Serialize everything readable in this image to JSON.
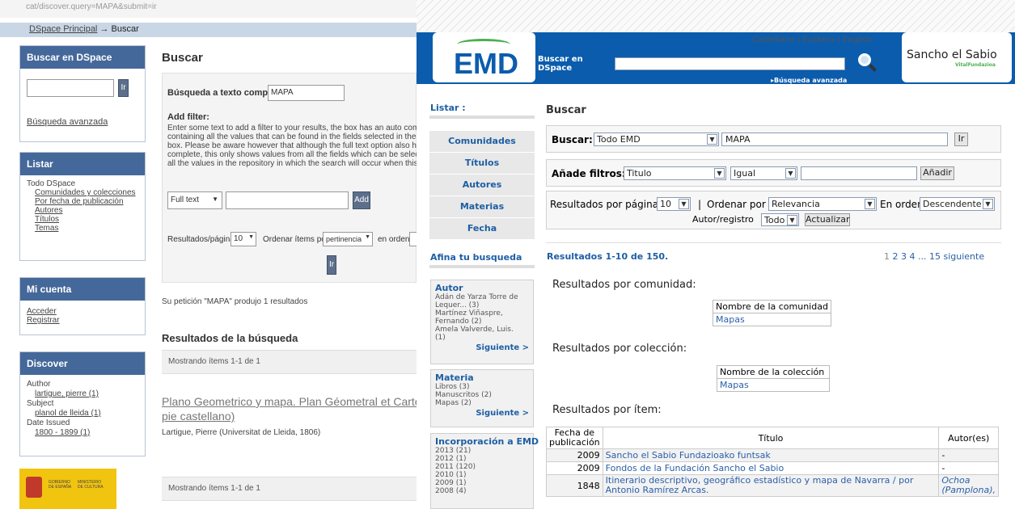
{
  "left": {
    "url": "cat/discover.query=MAPA&submit=ir",
    "breadcrumb": {
      "home": "DSpace Principal",
      "sep": "→",
      "current": "Buscar"
    },
    "search_box": {
      "title": "Buscar en DSpace",
      "go": "Ir",
      "advanced": "Búsqueda avanzada"
    },
    "browse": {
      "title": "Listar",
      "root": "Todo DSpace",
      "links": [
        "Comunidades y colecciones",
        "Por fecha de publicación",
        "Autores",
        "Títulos",
        "Temas"
      ]
    },
    "account": {
      "title": "Mi cuenta",
      "links": [
        "Acceder",
        "Registrar"
      ]
    },
    "discover": {
      "title": "Discover",
      "author_label": "Author",
      "author_value": "lartigue, pierre (1)",
      "subject_label": "Subject",
      "subject_value": "planol de lleida (1)",
      "date_label": "Date Issued",
      "date_value": "1800 - 1899 (1)"
    },
    "logo": {
      "line1": "GOBIERNO",
      "line1b": "DE ESPAÑA",
      "line2": "MINISTERIO",
      "line2b": "DE CULTURA"
    },
    "main": {
      "title": "Buscar",
      "fulltext_label": "Búsqueda a texto completo:",
      "fulltext_value": "MAPA",
      "addfilter_title": "Add filter:",
      "addfilter_help": [
        "Enter some text to add a filter to your results, the box has an auto complete functio",
        "containing all the values that can be found in the fields selected in the dropdow",
        "box. Please be aware however that although the full text option also has an aut",
        "complete, this only shows values from all the fields which can be selected & not fo",
        "all the values in the repository in which the search will occur when this is selected."
      ],
      "filter_select": "Full text",
      "add_btn": "Add",
      "results_per_page_label": "Resultados/página",
      "results_per_page": "10",
      "order_by_label": "Ordenar ítems por",
      "order_by": "pertinencia",
      "order_label": "en orden",
      "go": "Ir",
      "request_msg": "Su petición \"MAPA\" produjo 1 resultados",
      "results_title": "Resultados de la búsqueda",
      "showing": "Mostrando ítems 1-1 de 1",
      "item_title_1": "Plano Geometrico y mapa. Plan Géometral et Carte. Geometral Pl",
      "item_title_2": "pie castellano)",
      "item_meta": "Lartigue, Pierre (Universitat de Lleida, 1806)",
      "showing_bottom": "Mostrando ítems 1-1 de 1"
    }
  },
  "right": {
    "langs": [
      "Castellano",
      "Euskera",
      "English"
    ],
    "lang_sep": "|",
    "logo_text": "EMD",
    "search_label": "Buscar en DSpace",
    "advanced": "▸Búsqueda avanzada",
    "sancho": {
      "title": "Sancho el Sabio",
      "sub": "VitalFundazioa"
    },
    "browse_title": "Listar :",
    "browse_tabs": [
      "Comunidades",
      "Títulos",
      "Autores",
      "Materias",
      "Fecha"
    ],
    "refine_title": "Afina tu busqueda",
    "facets": {
      "author": {
        "title": "Autor",
        "items": [
          "Adán de Yarza Torre de",
          "Lequer... (3)",
          "Martínez Viñaspre,",
          "Fernando (2)",
          "Amela Valverde, Luis.",
          "(1)"
        ],
        "next": "Siguiente >"
      },
      "subject": {
        "title": "Materia",
        "items": [
          "Libros (3)",
          "Manuscritos (2)",
          "Mapas (2)"
        ],
        "next": "Siguiente >"
      },
      "date": {
        "title": "Incorporación a EMD",
        "items": [
          "2013 (21)",
          "2012 (1)",
          "2011 (120)",
          "2010 (1)",
          "2009 (1)",
          "2008 (4)"
        ]
      }
    },
    "main": {
      "title": "Buscar",
      "search_label": "Buscar:",
      "scope": "Todo EMD",
      "query": "MAPA",
      "go": "Ir",
      "filters_label": "Añade filtros:",
      "filter_field": "Titulo",
      "filter_op": "Igual",
      "add_btn": "Añadir",
      "rpp_label": "Resultados por página",
      "rpp": "10",
      "sep": "|",
      "order_by_label": "Ordenar por",
      "order_by": "Relevancia",
      "order_label": "En orden",
      "order": "Descendente",
      "author_label": "Autor/registro",
      "author_value": "Todo",
      "update_btn": "Actualizar",
      "results_summary": "Resultados 1-10 de 150.",
      "pages": [
        "1",
        "2",
        "3",
        "4"
      ],
      "pages_more": "... 15 siguiente",
      "by_community": "Resultados por comunidad:",
      "community_header": "Nombre de la comunidad",
      "community_value": "Mapas",
      "by_collection": "Resultados por colección:",
      "collection_header": "Nombre de la colección",
      "collection_value": "Mapas",
      "by_item": "Resultados por ítem:",
      "table_headers": [
        "Fecha de",
        "publicación",
        "Título",
        "Autor(es)"
      ],
      "rows": [
        {
          "date": "2009",
          "title": "Sancho el Sabio Fundazioako funtsak",
          "author": "-"
        },
        {
          "date": "2009",
          "title": "Fondos de la Fundación Sancho el Sabio",
          "author": "-"
        },
        {
          "date": "1848",
          "title": "Itinerario descriptivo, geográfico estadístico y mapa de Navarra / por",
          "title2": "Antonio Ramírez Arcas.",
          "author": "Ochoa",
          "author2": "(Pamplona),"
        }
      ]
    }
  }
}
